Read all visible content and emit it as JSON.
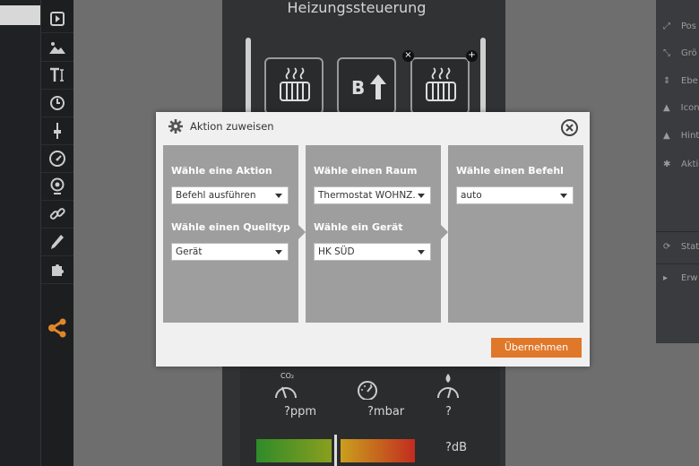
{
  "app": {
    "heading": "Heizungssteuerung"
  },
  "tiles": [
    {
      "icon": "radiator-icon"
    },
    {
      "icon": "boost-icon",
      "label": "B"
    },
    {
      "icon": "radiator-icon"
    }
  ],
  "tile_actions": {
    "remove": "×",
    "add": "+"
  },
  "sensors": [
    {
      "sub": "CO₂",
      "value": "?ppm",
      "icon": "co2-gauge-icon"
    },
    {
      "value": "?mbar",
      "icon": "pressure-gauge-icon"
    },
    {
      "value": "?",
      "icon": "humidity-gauge-icon"
    }
  ],
  "noise": {
    "value": "?dB"
  },
  "right_panel": {
    "items": [
      {
        "icon": "position-icon",
        "label": "Pos"
      },
      {
        "icon": "resize-icon",
        "label": "Grö"
      },
      {
        "icon": "layer-icon",
        "label": "Ebe"
      },
      {
        "icon": "image-icon",
        "label": "Icon"
      },
      {
        "icon": "image-icon",
        "label": "Hint"
      },
      {
        "icon": "gear-icon",
        "label": "Akti"
      },
      {
        "icon": "refresh-icon",
        "label": "Stat"
      },
      {
        "icon": "chevron-right-icon",
        "label": "Erw"
      }
    ]
  },
  "dialog": {
    "title": "Aktion zuweisen",
    "columns": [
      {
        "fields": [
          {
            "label": "Wähle eine Aktion",
            "value": "Befehl ausführen"
          },
          {
            "label": "Wähle einen Quelltyp",
            "value": "Gerät"
          }
        ]
      },
      {
        "fields": [
          {
            "label": "Wähle einen Raum",
            "value": "Thermostat WOHNZ..."
          },
          {
            "label": "Wähle ein Gerät",
            "value": "HK SÜD"
          }
        ]
      },
      {
        "fields": [
          {
            "label": "Wähle einen Befehl",
            "value": "auto"
          }
        ]
      }
    ],
    "apply_label": "Übernehmen"
  },
  "colors": {
    "accent": "#e0782a",
    "share_icon": "#e0872a"
  }
}
